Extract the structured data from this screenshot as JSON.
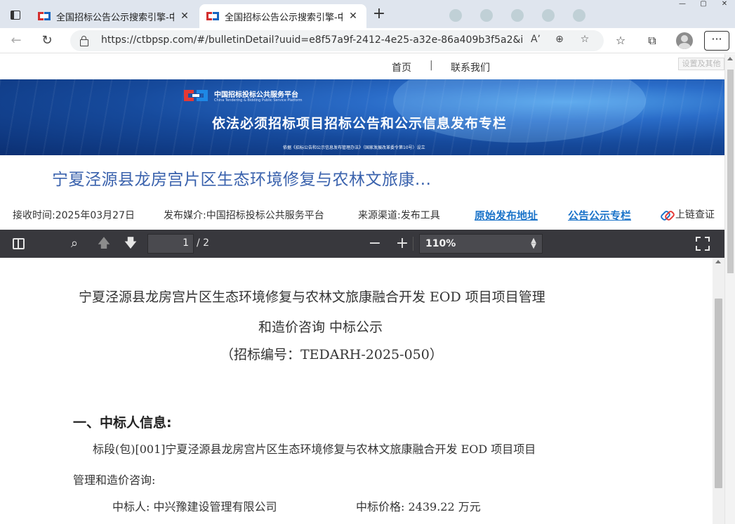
{
  "browser": {
    "tabs": [
      {
        "title": "全国招标公告公示搜索引擎-中国",
        "close": "✕"
      },
      {
        "title": "全国招标公告公示搜索引擎-中国",
        "close": "✕"
      }
    ],
    "new_tab": "+",
    "url": "https://ctbpsp.com/#/bulletinDetail?uuid=e8f57a9f-2412-4e25-a32e-86a409b3f5a2&inpvalue=...",
    "read_aloud": "Aʼ",
    "more_menu": "···"
  },
  "site": {
    "nav": {
      "home": "首页",
      "separator": "|",
      "contact": "联系我们"
    },
    "settings_tip": "设置及其他",
    "banner": {
      "org_cn": "中国招标投标公共服务平台",
      "org_en": "China Tendering & Bidding Public Service Platform",
      "title": "依法必须招标项目招标公告和公示信息发布专栏",
      "note": "依据《招标公告和公示信息发布管理办法》（国家发展改革委令第10号）设立"
    },
    "title": "宁夏泾源县龙房宫片区生态环境修复与农林文旅康...",
    "meta": {
      "received": "接收时间:2025年03月27日",
      "media": "发布媒介:中国招标投标公共服务平台",
      "source": "来源渠道:发布工具",
      "original_link": "原始发布地址",
      "column_link": "公告公示专栏",
      "chain": "上链查证"
    }
  },
  "pdf": {
    "page_current": "1",
    "page_total": "/ 2",
    "zoom": "110%",
    "content": {
      "title_line1": "宁夏泾源县龙房宫片区生态环境修复与农林文旅康融合开发 EOD 项目项目管理",
      "title_line2": "和造价咨询 中标公示",
      "bid_no": "（招标编号：TEDARH-2025-050）",
      "section1": "一、中标人信息:",
      "lot_line1": "标段(包)[001]宁夏泾源县龙房宫片区生态环境修复与农林文旅康融合开发 EOD 项目项目",
      "lot_line2": "管理和造价咨询:",
      "winner": "中标人: 中兴豫建设管理有限公司",
      "price": "中标价格: 2439.22 万元"
    }
  }
}
